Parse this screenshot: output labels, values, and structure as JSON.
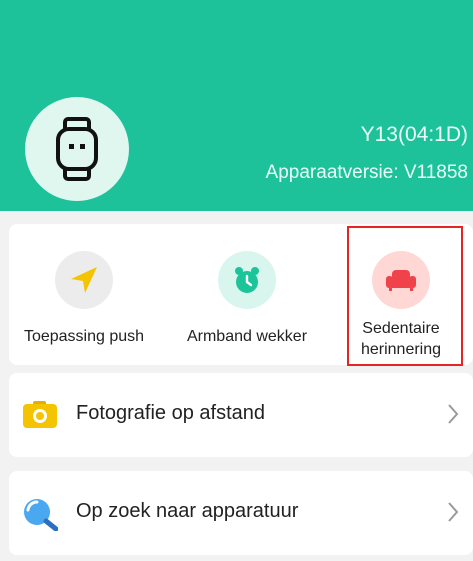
{
  "device": {
    "name": "Y13(04:1D)",
    "version": "Apparaatversie: V11858"
  },
  "features": [
    {
      "label": "Toepassing push",
      "icon": "send-icon",
      "color": "#f5c400",
      "bg": "#ececec"
    },
    {
      "label": "Armband wekker",
      "icon": "alarm-clock-icon",
      "color": "#1cc49a",
      "bg": "#d9f6ee"
    },
    {
      "label": "Sedentaire herinnering",
      "icon": "sofa-icon",
      "color": "#f0424a",
      "bg": "#ffd8d6",
      "selected": true
    }
  ],
  "rows": [
    {
      "label": "Fotografie op afstand",
      "icon": "camera-icon"
    },
    {
      "label": "Op zoek naar apparatuur",
      "icon": "search-icon"
    }
  ],
  "colors": {
    "accent": "#1dc29b",
    "selection_border": "#e52521"
  }
}
